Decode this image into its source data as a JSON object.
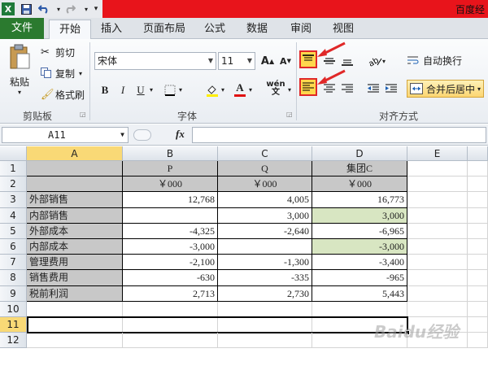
{
  "window": {
    "title": "百度经"
  },
  "tabs": [
    {
      "label": "文件"
    },
    {
      "label": "开始"
    },
    {
      "label": "插入"
    },
    {
      "label": "页面布局"
    },
    {
      "label": "公式"
    },
    {
      "label": "数据"
    },
    {
      "label": "审阅"
    },
    {
      "label": "视图"
    }
  ],
  "clipboard": {
    "paste": "粘贴",
    "cut": "剪切",
    "copy": "复制",
    "format_painter": "格式刷",
    "group": "剪贴板"
  },
  "font": {
    "name": "宋体",
    "size": "11",
    "group": "字体",
    "bold": "B",
    "italic": "I",
    "underline": "U",
    "font_color": "A",
    "wen": "wén",
    "grow": "A",
    "shrink": "A"
  },
  "align": {
    "wrap": "自动换行",
    "merge": "合并后居中",
    "group": "对齐方式"
  },
  "formula_bar": {
    "name_box": "A11",
    "fx": "fx",
    "content": ""
  },
  "sheet": {
    "columns": [
      "A",
      "B",
      "C",
      "D",
      "E"
    ],
    "rows": [
      "1",
      "2",
      "3",
      "4",
      "5",
      "6",
      "7",
      "8",
      "9",
      "10",
      "11",
      "12"
    ],
    "header_row1": [
      "P",
      "Q",
      "集团C"
    ],
    "header_row2": [
      "￥000",
      "￥000",
      "￥000"
    ],
    "data": [
      {
        "label": "外部销售",
        "p": "12,768",
        "q": "4,005",
        "c": "16,773"
      },
      {
        "label": "内部销售",
        "p": "",
        "q": "3,000",
        "c": "3,000"
      },
      {
        "label": "外部成本",
        "p": "-4,325",
        "q": "-2,640",
        "c": "-6,965"
      },
      {
        "label": "内部成本",
        "p": "-3,000",
        "q": "",
        "c": "-3,000"
      },
      {
        "label": "管理费用",
        "p": "-2,100",
        "q": "-1,300",
        "c": "-3,400"
      },
      {
        "label": "销售费用",
        "p": "-630",
        "q": "-335",
        "c": "-965"
      },
      {
        "label": "税前利润",
        "p": "2,713",
        "q": "2,730",
        "c": "5,443"
      }
    ]
  },
  "watermark": "Baidu经验",
  "colors": {
    "file_tab": "#2b7a2f",
    "title_red": "#e8141b",
    "highlight": "#ffd84d",
    "arrow": "#e02828",
    "green_cell": "#d8e6c2"
  }
}
